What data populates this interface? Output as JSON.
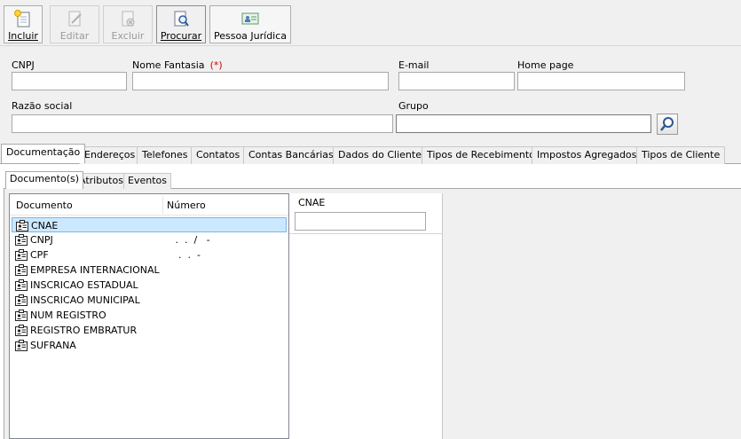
{
  "toolbar": {
    "buttons": [
      {
        "label": "Incluir",
        "enabled": true
      },
      {
        "label": "Editar",
        "enabled": false
      },
      {
        "label": "Excluir",
        "enabled": false
      },
      {
        "label": "Procurar",
        "enabled": true
      },
      {
        "label": "Pessoa Jurídica",
        "enabled": true
      }
    ]
  },
  "form": {
    "cnpj": {
      "label": "CNPJ",
      "value": ""
    },
    "nome_fantasia": {
      "label": "Nome Fantasia",
      "required_marker": "(*)",
      "value": ""
    },
    "email": {
      "label": "E-mail",
      "value": ""
    },
    "home_page": {
      "label": "Home page",
      "value": ""
    },
    "razao_social": {
      "label": "Razão social",
      "value": ""
    },
    "grupo": {
      "label": "Grupo",
      "value": ""
    }
  },
  "tabs": [
    "Documentação",
    "Endereços",
    "Telefones",
    "Contatos",
    "Contas Bancárias",
    "Dados do Cliente",
    "Tipos de Recebimento",
    "Impostos Agregados",
    "Tipos de Cliente"
  ],
  "active_tab": "Documentação",
  "subtabs": [
    "Documento(s)",
    "Atributos",
    "Eventos"
  ],
  "documents": {
    "columns": [
      "Documento",
      "Número"
    ],
    "rows": [
      {
        "name": "CNAE",
        "number": ""
      },
      {
        "name": "CNPJ",
        "number": " .  .  /   -"
      },
      {
        "name": "CPF",
        "number": "  .  .  -"
      },
      {
        "name": "EMPRESA INTERNACIONAL",
        "number": ""
      },
      {
        "name": "INSCRICAO ESTADUAL",
        "number": ""
      },
      {
        "name": "INSCRICAO MUNICIPAL",
        "number": ""
      },
      {
        "name": "NUM REGISTRO",
        "number": ""
      },
      {
        "name": "REGISTRO EMBRATUR",
        "number": ""
      },
      {
        "name": "SUFRANA",
        "number": ""
      }
    ],
    "selected_index": 0
  },
  "cnae_panel": {
    "label": "CNAE",
    "value": ""
  },
  "colors": {
    "selection_bg": "#cce8ff",
    "selection_border": "#7ab7ea",
    "required": "#d40000"
  }
}
